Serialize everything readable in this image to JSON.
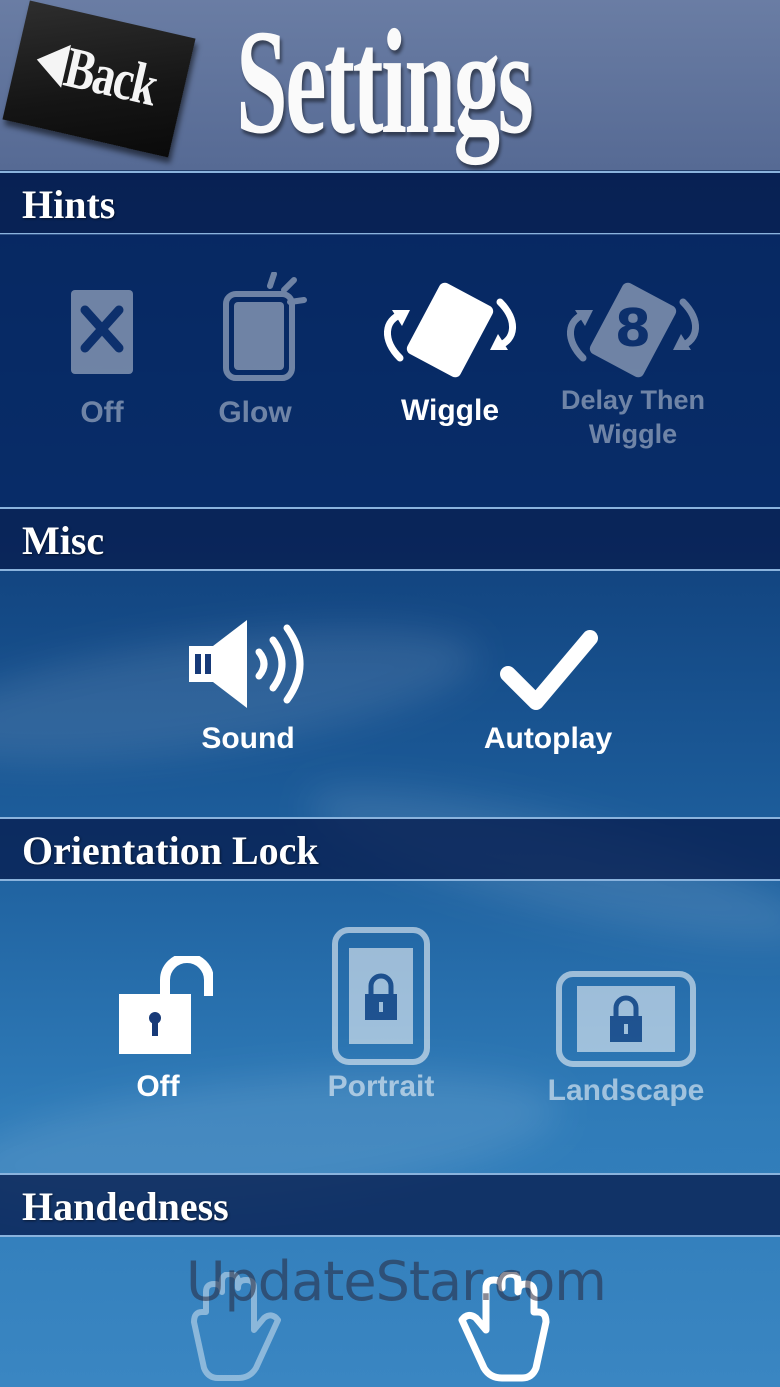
{
  "header": {
    "back_label": "Back",
    "title": "Settings"
  },
  "sections": {
    "hints": {
      "label": "Hints",
      "options": [
        {
          "label": "Off",
          "icon": "box-x-icon",
          "selected": false
        },
        {
          "label": "Glow",
          "icon": "glow-card-icon",
          "selected": false
        },
        {
          "label": "Wiggle",
          "icon": "wiggle-card-icon",
          "selected": true
        },
        {
          "label": "Delay Then Wiggle",
          "icon": "delay-wiggle-icon",
          "selected": false
        }
      ]
    },
    "misc": {
      "label": "Misc",
      "options": [
        {
          "label": "Sound",
          "icon": "speaker-icon",
          "selected": true
        },
        {
          "label": "Autoplay",
          "icon": "checkmark-icon",
          "selected": true
        }
      ]
    },
    "orientation": {
      "label": "Orientation Lock",
      "options": [
        {
          "label": "Off",
          "icon": "unlocked-padlock-icon",
          "selected": true
        },
        {
          "label": "Portrait",
          "icon": "portrait-lock-icon",
          "selected": false
        },
        {
          "label": "Landscape",
          "icon": "landscape-lock-icon",
          "selected": false
        }
      ]
    },
    "handedness": {
      "label": "Handedness",
      "options": [
        {
          "icon": "left-hand-icon",
          "selected": false
        },
        {
          "icon": "right-hand-icon",
          "selected": true
        }
      ]
    }
  },
  "watermark": "UpdateStar.com",
  "colors": {
    "header_bg": "#566a94",
    "section_bar_bg": "#0a2458",
    "divider": "#8ab3dd",
    "selected_text": "#ffffff"
  }
}
